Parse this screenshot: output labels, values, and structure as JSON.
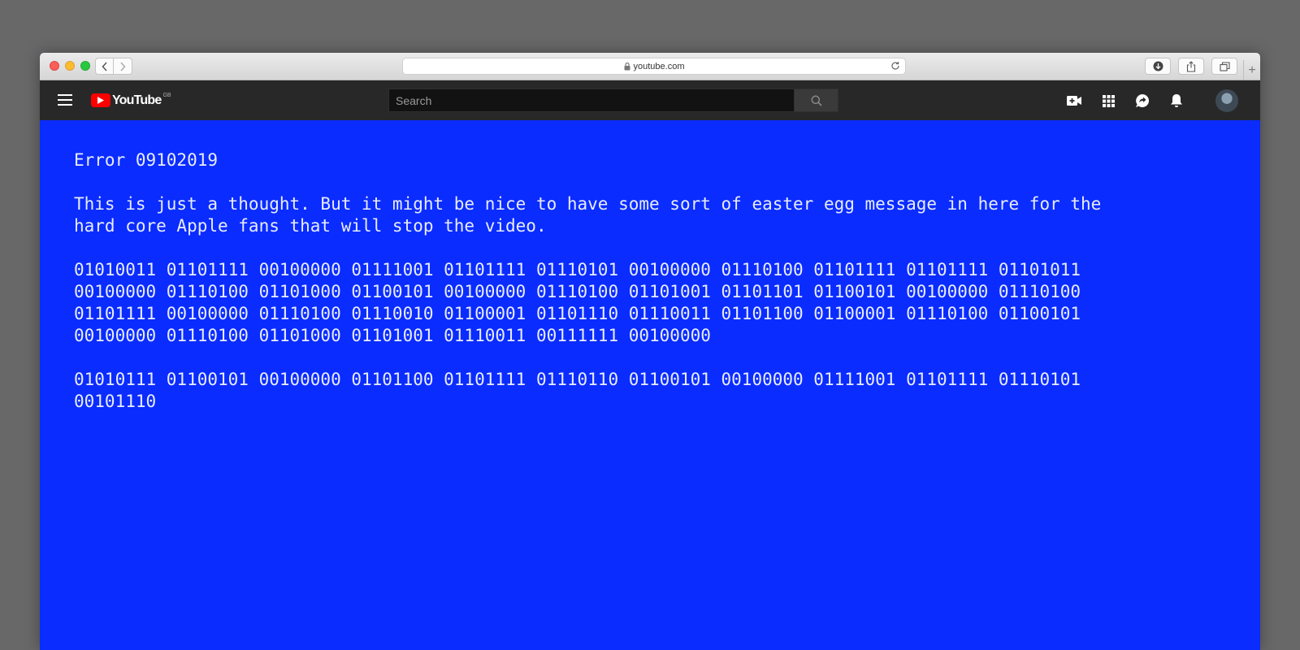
{
  "browser": {
    "url": "youtube.com"
  },
  "youtube": {
    "logo_text": "YouTube",
    "country_code": "GB",
    "search_placeholder": "Search"
  },
  "content": {
    "error_title": "Error 09102019",
    "message_line1": "This is just a thought. But it might be nice to have some sort of easter egg message in here for the",
    "message_line2": "hard core Apple fans that will stop the video.",
    "binary_block1": [
      "01010011 01101111 00100000 01111001 01101111 01110101 00100000 01110100 01101111 01101111 01101011",
      "00100000 01110100 01101000 01100101 00100000 01110100 01101001 01101101 01100101 00100000 01110100",
      "01101111 00100000 01110100 01110010 01100001 01101110 01110011 01101100 01100001 01110100 01100101",
      "00100000 01110100 01101000 01101001 01110011 00111111 00100000"
    ],
    "binary_block2": [
      "01010111 01100101 00100000 01101100 01101111 01110110 01100101 00100000 01111001 01101111 01110101",
      "00101110"
    ]
  },
  "colors": {
    "page_background": "#0a2cff",
    "text": "#e8ecff",
    "yt_header": "#282828",
    "yt_red": "#ff0000"
  }
}
